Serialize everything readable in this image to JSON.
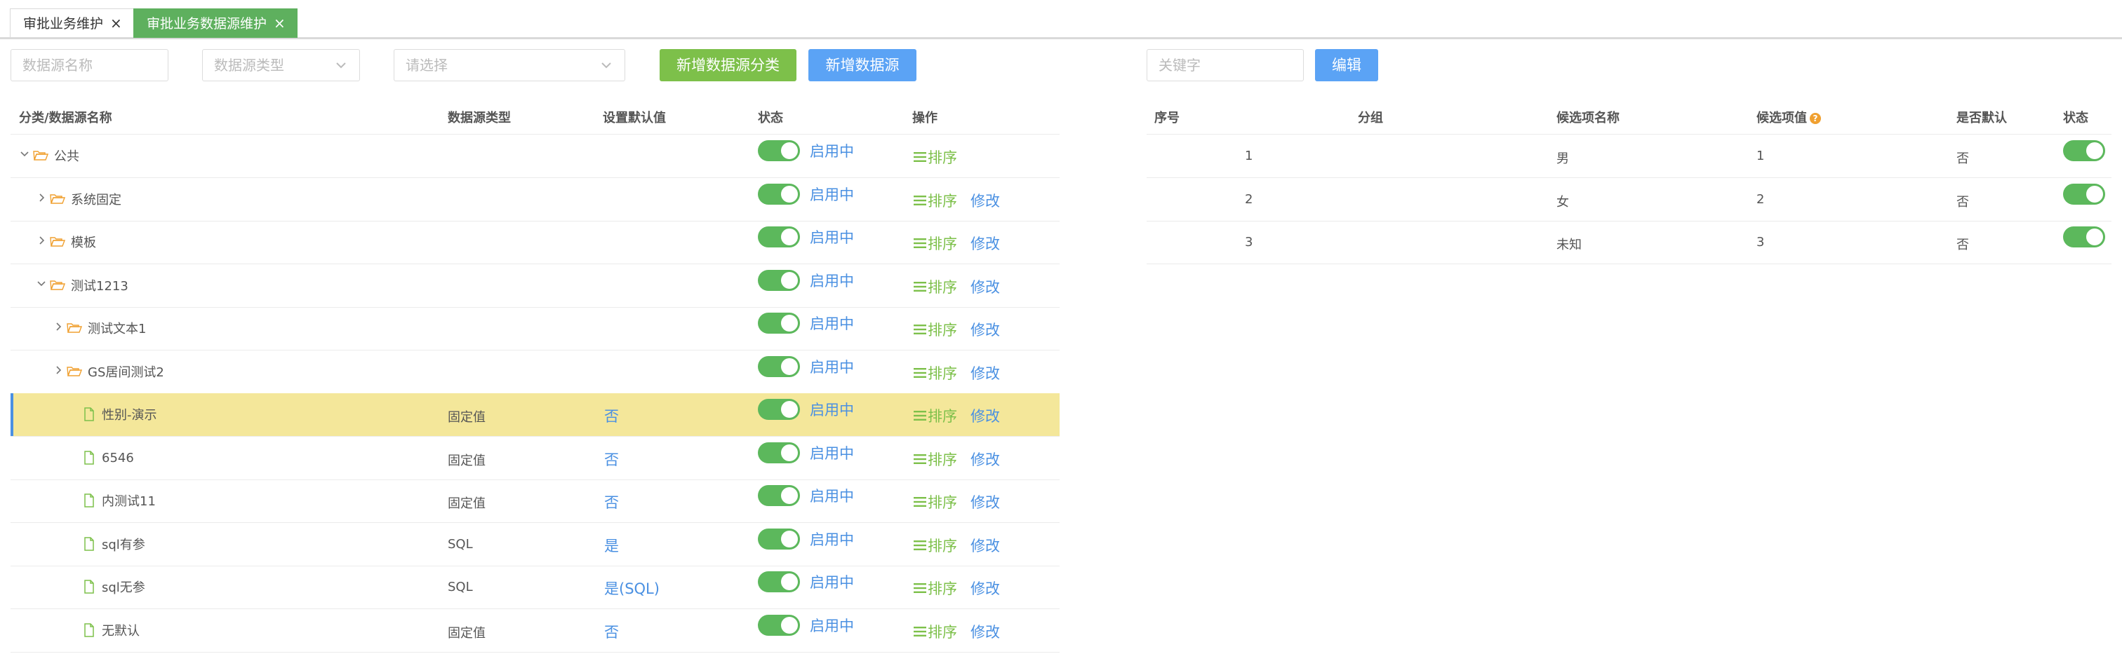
{
  "tabs": [
    {
      "label": "审批业务维护",
      "close": "×"
    },
    {
      "label": "审批业务数据源维护",
      "close": "×"
    }
  ],
  "toolbar": {
    "name_placeholder": "数据源名称",
    "type_placeholder": "数据源类型",
    "select_placeholder": "请选择",
    "add_category_label": "新增数据源分类",
    "add_source_label": "新增数据源",
    "keyword_placeholder": "关键字",
    "edit_label": "编辑"
  },
  "left_table": {
    "headers": {
      "name": "分类/数据源名称",
      "type": "数据源类型",
      "default": "设置默认值",
      "status": "状态",
      "ops": "操作"
    },
    "sort_label": "排序",
    "edit_label": "修改",
    "rows": [
      {
        "name": "公共",
        "type": "",
        "default": "",
        "status": "启用中",
        "kind": "folder",
        "expanded": true,
        "level": 0
      },
      {
        "name": "系统固定",
        "type": "",
        "default": "",
        "status": "启用中",
        "kind": "folder",
        "expanded": false,
        "level": 1
      },
      {
        "name": "模板",
        "type": "",
        "default": "",
        "status": "启用中",
        "kind": "folder",
        "expanded": false,
        "level": 1
      },
      {
        "name": "测试1213",
        "type": "",
        "default": "",
        "status": "启用中",
        "kind": "folder",
        "expanded": true,
        "level": 1
      },
      {
        "name": "测试文本1",
        "type": "",
        "default": "",
        "status": "启用中",
        "kind": "folder",
        "expanded": false,
        "level": 2
      },
      {
        "name": "GS居间测试2",
        "type": "",
        "default": "",
        "status": "启用中",
        "kind": "folder",
        "expanded": false,
        "level": 2
      },
      {
        "name": "性别-演示",
        "type": "固定值",
        "default": "否",
        "status": "启用中",
        "kind": "file",
        "level": 3,
        "selected": true
      },
      {
        "name": "6546",
        "type": "固定值",
        "default": "否",
        "status": "启用中",
        "kind": "file",
        "level": 3
      },
      {
        "name": "内测试11",
        "type": "固定值",
        "default": "否",
        "status": "启用中",
        "kind": "file",
        "level": 3
      },
      {
        "name": "sql有参",
        "type": "SQL",
        "default": "是",
        "status": "启用中",
        "kind": "file",
        "level": 3
      },
      {
        "name": "sql无参",
        "type": "SQL",
        "default": "是(SQL)",
        "status": "启用中",
        "kind": "file",
        "level": 3
      },
      {
        "name": "无默认",
        "type": "固定值",
        "default": "否",
        "status": "启用中",
        "kind": "file",
        "level": 3
      }
    ]
  },
  "right_table": {
    "headers": {
      "seq": "序号",
      "group": "分组",
      "option_name": "候选项名称",
      "option_value": "候选项值",
      "is_default": "是否默认",
      "status": "状态"
    },
    "rows": [
      {
        "seq": "1",
        "group": "",
        "option_name": "男",
        "option_value": "1",
        "is_default": "否"
      },
      {
        "seq": "2",
        "group": "",
        "option_name": "女",
        "option_value": "2",
        "is_default": "否"
      },
      {
        "seq": "3",
        "group": "",
        "option_name": "未知",
        "option_value": "3",
        "is_default": "否"
      }
    ]
  },
  "colors": {
    "accent_green": "#5eb05e",
    "button_green": "#7dc04a",
    "blue": "#4a90e2",
    "selected_row": "#f4e79a",
    "folder": "#f0a030"
  }
}
